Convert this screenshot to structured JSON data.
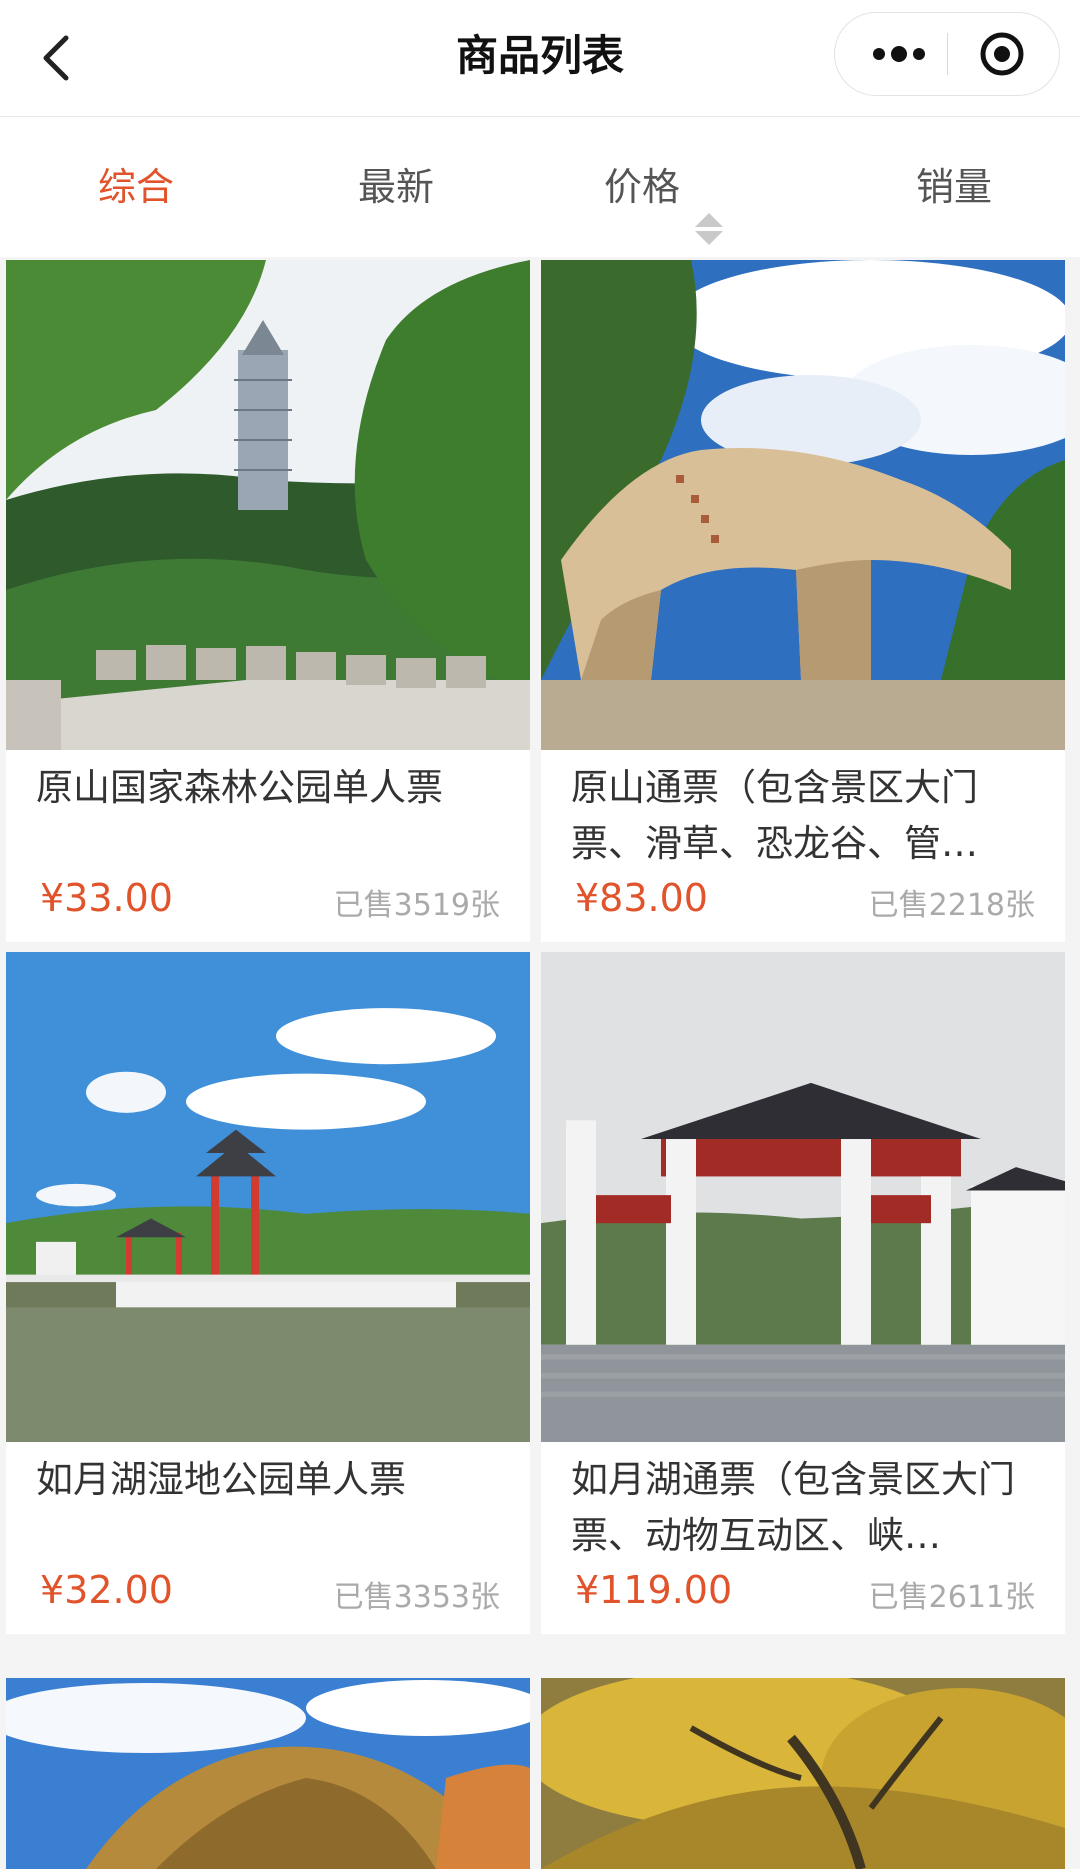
{
  "header": {
    "title": "商品列表"
  },
  "filters": [
    "综合",
    "最新",
    "价格",
    "销量"
  ],
  "colors": {
    "accent": "#e0532b",
    "text": "#333333",
    "muted": "#aaaaaa"
  },
  "products": [
    {
      "title": "原山国家森林公园单人票",
      "price": "¥33.00",
      "sold": "已售3519张"
    },
    {
      "title": "原山通票（包含景区大门票、滑草、恐龙谷、管…",
      "price": "¥83.00",
      "sold": "已售2218张"
    },
    {
      "title": "如月湖湿地公园单人票",
      "price": "¥32.00",
      "sold": "已售3353张"
    },
    {
      "title": "如月湖通票（包含景区大门票、动物互动区、峡…",
      "price": "¥119.00",
      "sold": "已售2611张"
    }
  ]
}
